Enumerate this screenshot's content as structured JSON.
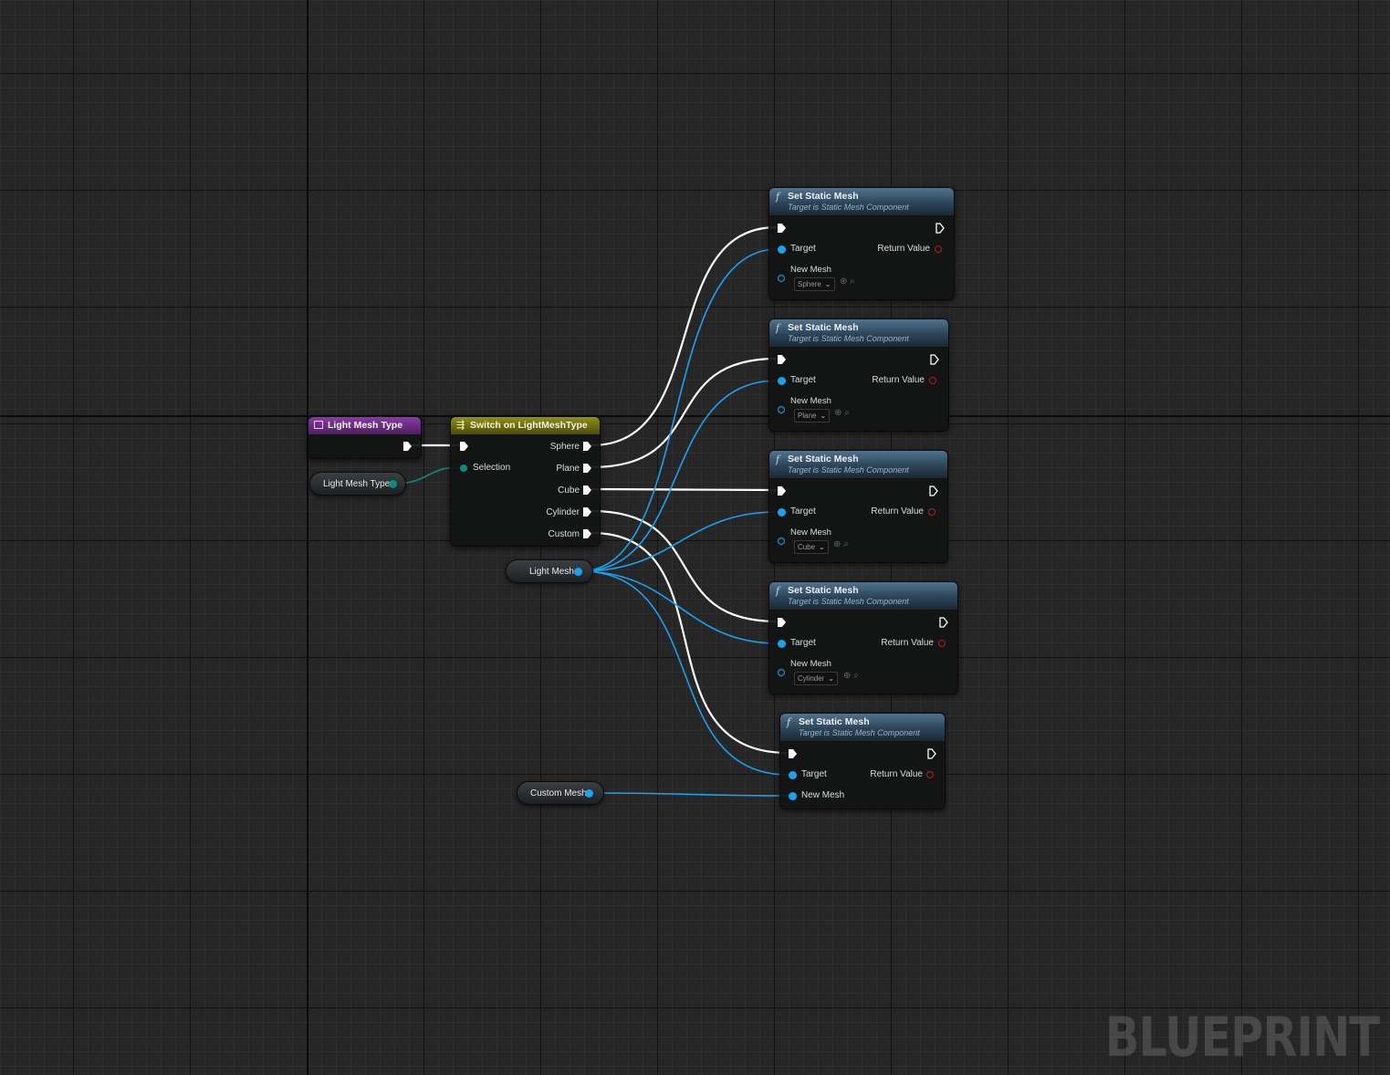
{
  "graph": {
    "watermark": "BLUEPRINT"
  },
  "colors": {
    "exec_wire": "#ffffff",
    "object_wire": "#19a3ef",
    "enum_wire": "#0b8a80",
    "function_header": "#2c4457",
    "event_header": "#7a2e92",
    "switch_header": "#8a8a12"
  },
  "light_mesh_type_event": {
    "title": "Light Mesh Type",
    "icon": "event-icon"
  },
  "light_mesh_type_var": {
    "label": "Light Mesh Type"
  },
  "switch_node": {
    "title": "Switch on LightMeshType",
    "icon": "switch-icon",
    "selection_label": "Selection",
    "outputs": [
      "Sphere",
      "Plane",
      "Cube",
      "Cylinder",
      "Custom"
    ]
  },
  "light_mesh_var": {
    "label": "Light Mesh"
  },
  "custom_mesh_var": {
    "label": "Custom Mesh"
  },
  "set_static_mesh_nodes": [
    {
      "title": "Set Static Mesh",
      "subtitle": "Target is Static Mesh Component",
      "target_label": "Target",
      "return_label": "Return Value",
      "new_mesh_label": "New Mesh",
      "mesh_value": "Sphere"
    },
    {
      "title": "Set Static Mesh",
      "subtitle": "Target is Static Mesh Component",
      "target_label": "Target",
      "return_label": "Return Value",
      "new_mesh_label": "New Mesh",
      "mesh_value": "Plane"
    },
    {
      "title": "Set Static Mesh",
      "subtitle": "Target is Static Mesh Component",
      "target_label": "Target",
      "return_label": "Return Value",
      "new_mesh_label": "New Mesh",
      "mesh_value": "Cube"
    },
    {
      "title": "Set Static Mesh",
      "subtitle": "Target is Static Mesh Component",
      "target_label": "Target",
      "return_label": "Return Value",
      "new_mesh_label": "New Mesh",
      "mesh_value": "Cylinder"
    },
    {
      "title": "Set Static Mesh",
      "subtitle": "Target is Static Mesh Component",
      "target_label": "Target",
      "return_label": "Return Value",
      "new_mesh_label": "New Mesh",
      "mesh_value": null
    }
  ]
}
